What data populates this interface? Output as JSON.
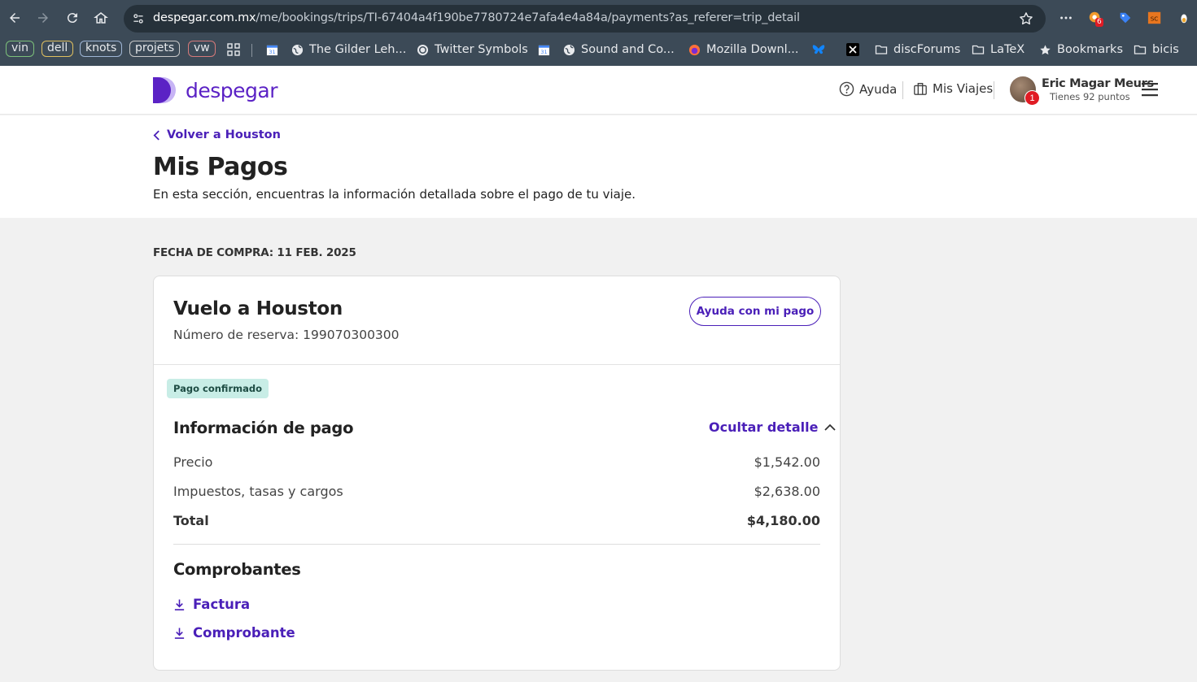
{
  "browser": {
    "url_host": "despegar.com.mx",
    "url_path": "/me/bookings/trips/TI-67404a4f190be7780724e7afa4e4a84a/payments?as_referer=trip_detail",
    "extension_badge": "6",
    "bookmark_tags": [
      {
        "label": "vin",
        "color": "#7cc07a"
      },
      {
        "label": "dell",
        "color": "#e0c060"
      },
      {
        "label": "knots",
        "color": "#9fb6d6"
      },
      {
        "label": "projets",
        "color": "#c8c8c8"
      },
      {
        "label": "vw",
        "color": "#d67a7a"
      }
    ],
    "bookmarks": [
      {
        "label": "The Gilder Leh..."
      },
      {
        "label": "Twitter Symbols"
      },
      {
        "label": "Sound and Co..."
      },
      {
        "label": "Mozilla Downl..."
      },
      {
        "label": "discForums"
      },
      {
        "label": "LaTeX"
      },
      {
        "label": "Bookmarks"
      },
      {
        "label": "bicis"
      }
    ]
  },
  "header": {
    "logo_text": "despegar",
    "help_label": "Ayuda",
    "trips_label": "Mis Viajes",
    "user_name": "Eric Magar Meurs",
    "user_points": "Tienes 92 puntos",
    "notification_count": "1"
  },
  "intro": {
    "back_label": "Volver a Houston",
    "title": "Mis Pagos",
    "subtitle": "En esta sección, encuentras la información detallada sobre el pago de tu viaje."
  },
  "purchase_date": "FECHA DE COMPRA: 11 FEB. 2025",
  "card": {
    "title": "Vuelo a Houston",
    "reservation": "Número de reserva: 199070300300",
    "help_button": "Ayuda con mi pago",
    "status": "Pago confirmado",
    "payment_title": "Información de pago",
    "toggle_label": "Ocultar detalle",
    "rows": [
      {
        "label": "Precio",
        "value": "$1,542.00"
      },
      {
        "label": "Impuestos, tasas y cargos",
        "value": "$2,638.00"
      },
      {
        "label": "Total",
        "value": "$4,180.00"
      }
    ],
    "receipts_title": "Comprobantes",
    "downloads": [
      {
        "label": "Factura"
      },
      {
        "label": "Comprobante"
      }
    ]
  },
  "colors": {
    "brand_purple": "#4a1fb8",
    "status_bg": "#c8ede6"
  }
}
